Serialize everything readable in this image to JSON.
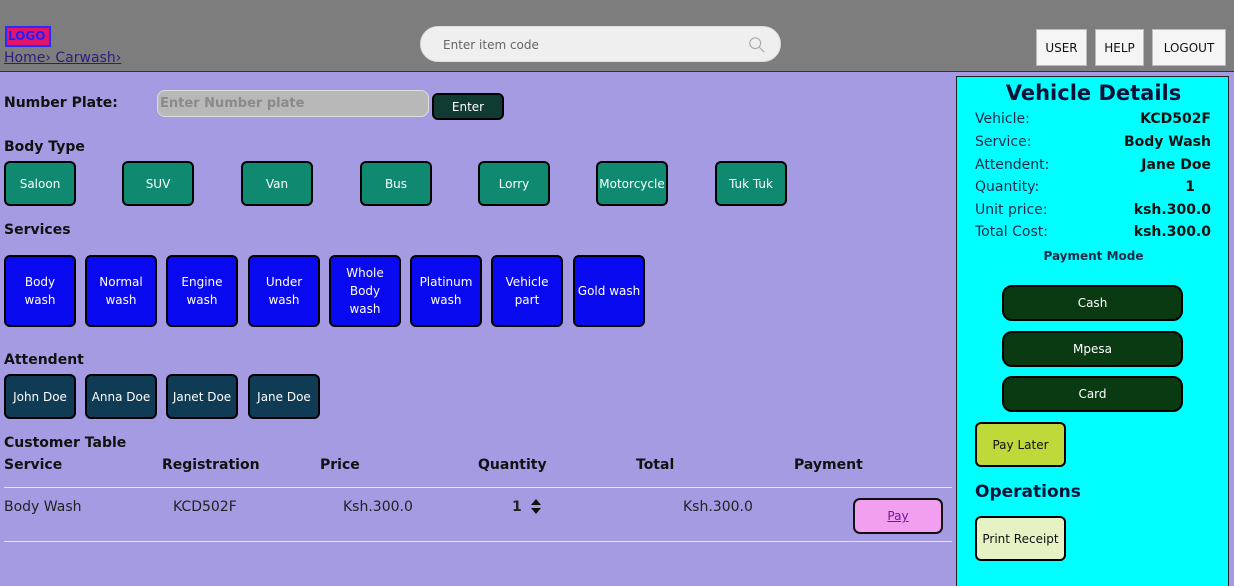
{
  "header": {
    "logo": "LOGO",
    "breadcrumb": [
      "Home",
      "Carwash"
    ],
    "search_placeholder": "Enter item code",
    "buttons": {
      "user": "USER",
      "help": "HELP",
      "logout": "LOGOUT"
    }
  },
  "number_plate": {
    "label": "Number Plate:",
    "placeholder": "Enter Number plate",
    "enter_label": "Enter"
  },
  "body_type": {
    "label": "Body Type",
    "items": [
      "Saloon",
      "SUV",
      "Van",
      "Bus",
      "Lorry",
      "Motorcycle",
      "Tuk Tuk"
    ]
  },
  "services": {
    "label": "Services",
    "items": [
      "Body wash",
      "Normal wash",
      "Engine wash",
      "Under wash",
      "Whole Body wash",
      "Platinum wash",
      "Vehicle part",
      "Gold wash"
    ]
  },
  "attendent": {
    "label": "Attendent",
    "items": [
      "John Doe",
      "Anna Doe",
      "Janet Doe",
      "Jane Doe"
    ]
  },
  "customer_table": {
    "label": "Customer Table",
    "columns": [
      "Service",
      "Registration",
      "Price",
      "Quantity",
      "Total",
      "Payment"
    ],
    "rows": [
      {
        "service": "Body Wash",
        "registration": "KCD502F",
        "price": "Ksh.300.0",
        "quantity": "1",
        "total": "Ksh.300.0",
        "pay_label": "Pay"
      }
    ]
  },
  "vehicle_details": {
    "title": "Vehicle Details",
    "rows": [
      {
        "key": "Vehicle:",
        "value": "KCD502F"
      },
      {
        "key": "Service:",
        "value": "Body Wash"
      },
      {
        "key": "Attendent:",
        "value": "Jane Doe"
      },
      {
        "key": "Quantity:",
        "value": "1"
      },
      {
        "key": "Unit price:",
        "value": "ksh.300.0"
      },
      {
        "key": "Total Cost:",
        "value": "ksh.300.0"
      }
    ],
    "payment_mode_label": "Payment Mode",
    "payment_modes": [
      "Cash",
      "Mpesa",
      "Card"
    ],
    "pay_later": "Pay Later",
    "operations_label": "Operations",
    "print_receipt": "Print Receipt"
  },
  "colors": {
    "background": "#a59be3",
    "header": "#7d7d7d",
    "body_type_button": "#0f8a70",
    "service_button": "#0a0af0",
    "attendent_button": "#0f3b55",
    "panel": "#00ffff",
    "payment_button": "#0a3a12",
    "pay_later": "#bfd83a",
    "pay_button": "#f29ff0"
  }
}
